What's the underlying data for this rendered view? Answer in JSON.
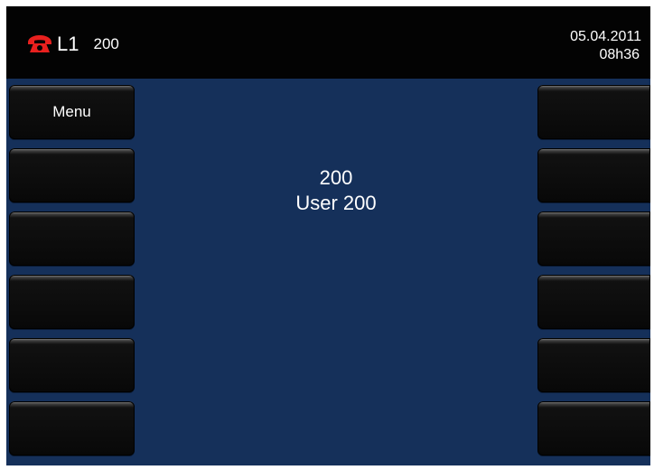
{
  "status_bar": {
    "line_label": "L1",
    "line_number": "200",
    "date": "05.04.2011",
    "time": "08h36",
    "icon": "phone-handset-icon",
    "icon_color": "#e8201e"
  },
  "softkeys_left": [
    {
      "label": "Menu"
    },
    {
      "label": ""
    },
    {
      "label": ""
    },
    {
      "label": ""
    },
    {
      "label": ""
    },
    {
      "label": ""
    }
  ],
  "softkeys_right": [
    {
      "label": ""
    },
    {
      "label": ""
    },
    {
      "label": ""
    },
    {
      "label": ""
    },
    {
      "label": ""
    },
    {
      "label": ""
    }
  ],
  "main": {
    "extension": "200",
    "user_name": "User 200"
  },
  "colors": {
    "background": "#15305a",
    "status_bar": "#030303",
    "text": "#ffffff"
  }
}
